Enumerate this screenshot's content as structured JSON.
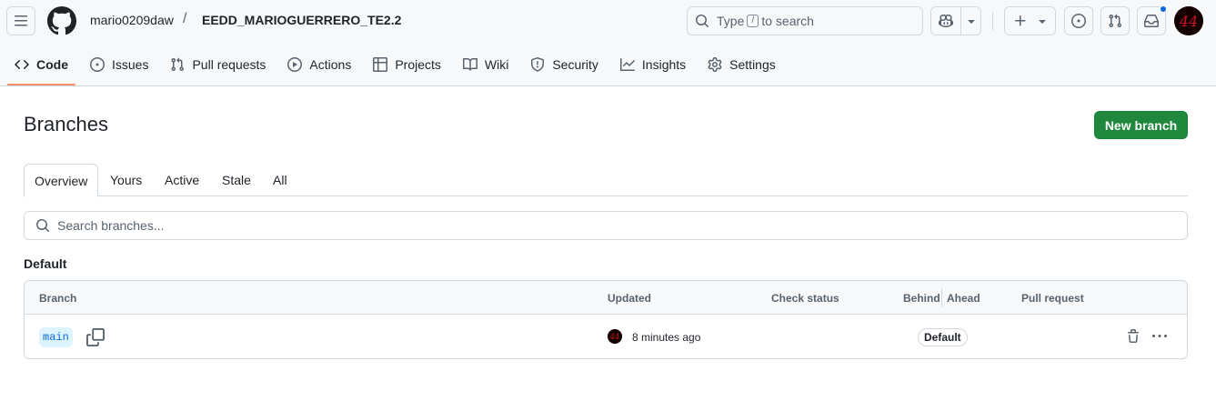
{
  "header": {
    "owner": "mario0209daw",
    "separator": "/",
    "repo": "EEDD_MARIOGUERRERO_TE2.2",
    "search_prefix": "Type",
    "search_key": "/",
    "search_suffix": "to search",
    "avatar_text": "44"
  },
  "nav": {
    "items": [
      {
        "label": "Code",
        "icon": "code-icon"
      },
      {
        "label": "Issues",
        "icon": "issue-icon"
      },
      {
        "label": "Pull requests",
        "icon": "pull-request-icon"
      },
      {
        "label": "Actions",
        "icon": "play-icon"
      },
      {
        "label": "Projects",
        "icon": "table-icon"
      },
      {
        "label": "Wiki",
        "icon": "book-icon"
      },
      {
        "label": "Security",
        "icon": "shield-icon"
      },
      {
        "label": "Insights",
        "icon": "graph-icon"
      },
      {
        "label": "Settings",
        "icon": "gear-icon"
      }
    ],
    "active": "Code"
  },
  "page": {
    "title": "Branches",
    "new_branch_label": "New branch",
    "tabs": [
      "Overview",
      "Yours",
      "Active",
      "Stale",
      "All"
    ],
    "active_tab": "Overview",
    "search_placeholder": "Search branches...",
    "section_label": "Default"
  },
  "table": {
    "columns": [
      "Branch",
      "Updated",
      "Check status",
      "Behind",
      "Ahead",
      "Pull request"
    ],
    "rows": [
      {
        "branch": "main",
        "updated": "8 minutes ago",
        "badge": "Default"
      }
    ]
  },
  "colors": {
    "accent": "#0969da",
    "primary_button": "#1f883d",
    "active_tab_underline": "#fd8c73"
  }
}
